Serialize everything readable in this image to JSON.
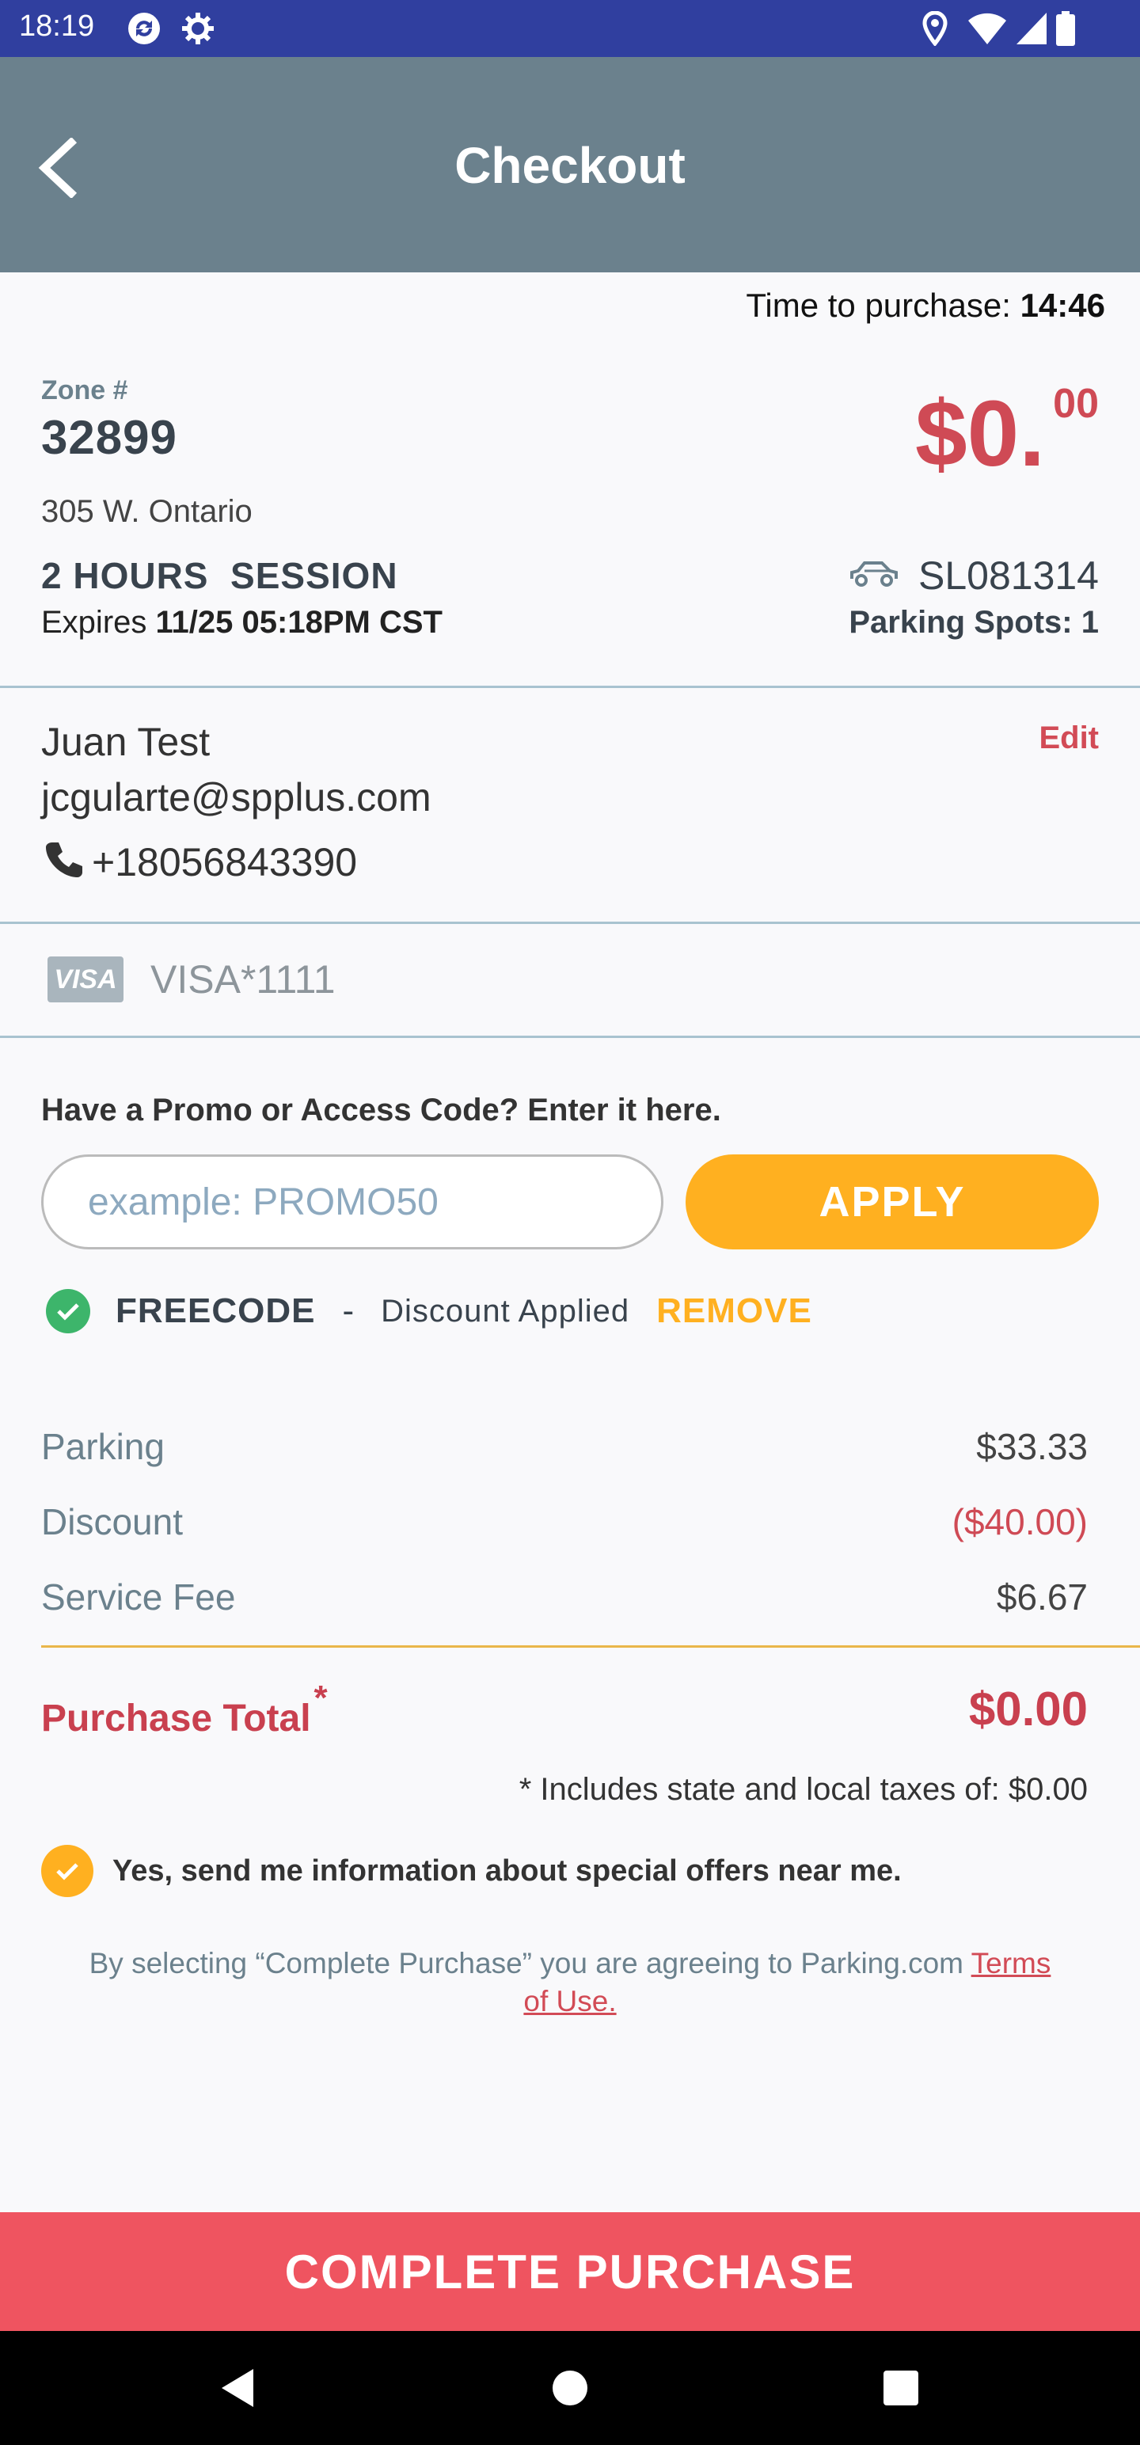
{
  "status_bar": {
    "time": "18:19"
  },
  "header": {
    "title": "Checkout"
  },
  "timer": {
    "label": "Time to purchase:",
    "value": "14:46"
  },
  "zone": {
    "label": "Zone #",
    "number": "32899",
    "address": "305 W. Ontario",
    "session": "2 HOURS  SESSION",
    "expires_label": "Expires",
    "expires_value": "11/25 05:18PM CST"
  },
  "price": {
    "dollars": "$0.",
    "cents": "00"
  },
  "vehicle": {
    "plate": "SL081314",
    "spots_label": "Parking Spots:",
    "spots_value": "1"
  },
  "contact": {
    "name": "Juan Test",
    "email": "jcgularte@spplus.com",
    "phone": "+18056843390",
    "edit_label": "Edit"
  },
  "payment": {
    "brand": "VISA",
    "card": "VISA*1111"
  },
  "promo": {
    "title": "Have a Promo or Access Code? Enter it here.",
    "placeholder": "example: PROMO50",
    "apply_label": "APPLY",
    "applied_code": "FREECODE",
    "separator": "-",
    "applied_text": "Discount Applied",
    "remove_label": "REMOVE"
  },
  "summary": {
    "lines": [
      {
        "label": "Parking",
        "value": "$33.33"
      },
      {
        "label": "Discount",
        "value": "($40.00)"
      },
      {
        "label": "Service Fee",
        "value": "$6.67"
      }
    ],
    "total_label": "Purchase Total",
    "total_marker": "*",
    "total_value": "$0.00",
    "taxes_note": "* Includes state and local taxes of: $0.00"
  },
  "offers": {
    "label": "Yes, send me information about special offers near me.",
    "checked": true
  },
  "agreement": {
    "text": "By selecting “Complete Purchase” you are agreeing to Parking.com ",
    "link": "Terms of Use."
  },
  "cta": {
    "label": "COMPLETE PURCHASE"
  },
  "colors": {
    "header": "#6b818d",
    "accent": "#ffb020",
    "danger": "#ef5460",
    "status_bar": "#303f9f"
  }
}
